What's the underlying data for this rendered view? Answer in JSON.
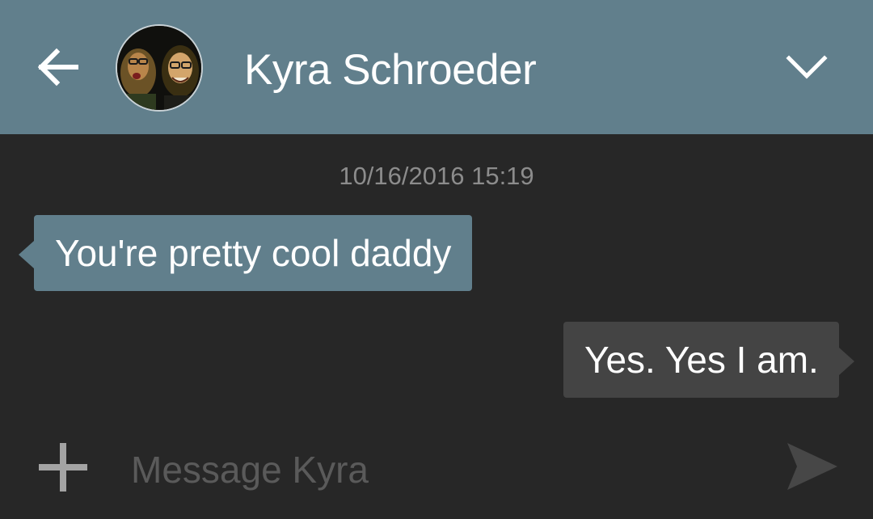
{
  "header": {
    "contact_name": "Kyra Schroeder",
    "back_icon": "arrow-left-icon",
    "menu_icon": "chevron-down-icon",
    "avatar": "contact-avatar-photo"
  },
  "colors": {
    "header_bg": "#617f8c",
    "page_bg": "#272727",
    "incoming_bubble": "#617f8c",
    "outgoing_bubble": "#444444",
    "timestamp_text": "#8c8c8c",
    "placeholder_text": "#5a5a5a"
  },
  "conversation": {
    "timestamp": "10/16/2016 15:19",
    "messages": [
      {
        "direction": "incoming",
        "text": "You're pretty cool daddy"
      },
      {
        "direction": "outgoing",
        "text": "Yes. Yes I am."
      }
    ]
  },
  "composer": {
    "placeholder": "Message Kyra",
    "add_icon": "plus-icon",
    "send_icon": "send-icon"
  }
}
